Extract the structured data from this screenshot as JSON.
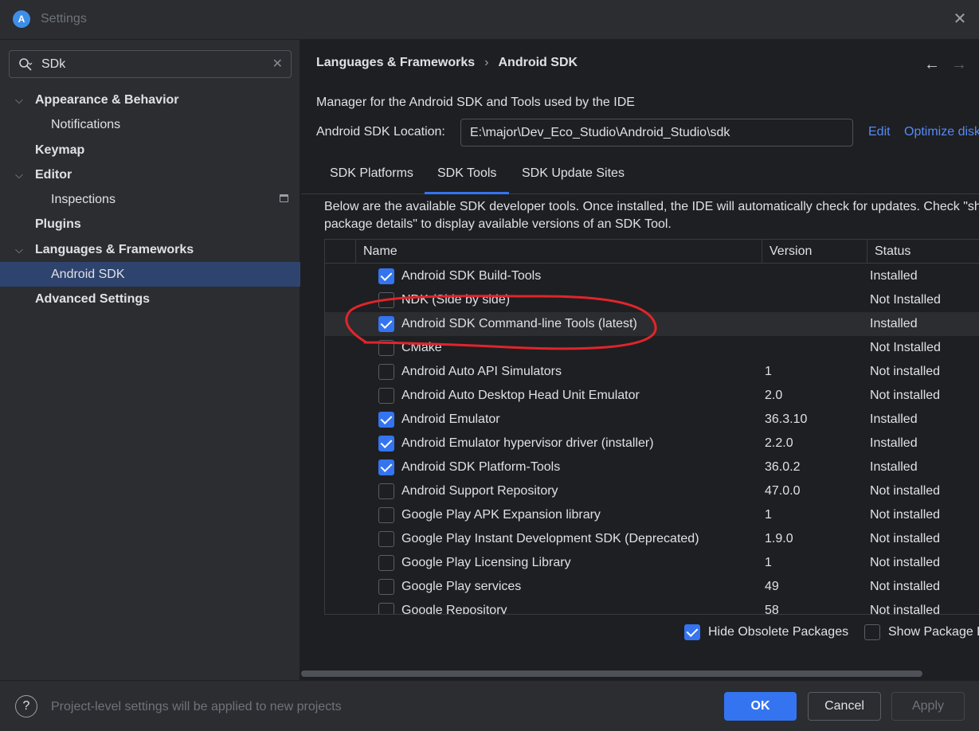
{
  "window": {
    "title": "Settings",
    "logo_glyph": "A"
  },
  "sidebar": {
    "search": {
      "value": "SDk",
      "placeholder": ""
    },
    "items": [
      {
        "label": "Appearance & Behavior",
        "expanded": true
      },
      {
        "label": "Notifications"
      },
      {
        "label": "Keymap"
      },
      {
        "label": "Editor",
        "expanded": true
      },
      {
        "label": "Inspections"
      },
      {
        "label": "Plugins"
      },
      {
        "label": "Languages & Frameworks",
        "expanded": true
      },
      {
        "label": "Android SDK",
        "selected": true
      },
      {
        "label": "Advanced Settings"
      }
    ]
  },
  "main": {
    "breadcrumb": [
      "Languages & Frameworks",
      "Android SDK"
    ],
    "description": "Manager for the Android SDK and Tools used by the IDE",
    "location_label": "Android SDK Location:",
    "location_value": "E:\\major\\Dev_Eco_Studio\\Android_Studio\\sdk",
    "edit_link": "Edit",
    "optimize_link": "Optimize disk space",
    "tabs": [
      "SDK Platforms",
      "SDK Tools",
      "SDK Update Sites"
    ],
    "active_tab": "SDK Tools",
    "info_line1": "Below are the available SDK developer tools. Once installed, the IDE will automatically check for updates. Check \"show",
    "info_line2": "package details\" to display available versions of an SDK Tool.",
    "columns": {
      "name": "Name",
      "version": "Version",
      "status": "Status"
    },
    "rows": [
      {
        "checked": true,
        "name": "Android SDK Build-Tools",
        "version": "",
        "status": "Installed"
      },
      {
        "checked": false,
        "name": "NDK (Side by side)",
        "version": "",
        "status": "Not Installed"
      },
      {
        "checked": true,
        "name": "Android SDK Command-line Tools (latest)",
        "version": "",
        "status": "Installed",
        "highlight": true
      },
      {
        "checked": false,
        "name": "CMake",
        "version": "",
        "status": "Not Installed"
      },
      {
        "checked": false,
        "name": "Android Auto API Simulators",
        "version": "1",
        "status": "Not installed"
      },
      {
        "checked": false,
        "name": "Android Auto Desktop Head Unit Emulator",
        "version": "2.0",
        "status": "Not installed"
      },
      {
        "checked": true,
        "name": "Android Emulator",
        "version": "36.3.10",
        "status": "Installed"
      },
      {
        "checked": true,
        "name": "Android Emulator hypervisor driver (installer)",
        "version": "2.2.0",
        "status": "Installed"
      },
      {
        "checked": true,
        "name": "Android SDK Platform-Tools",
        "version": "36.0.2",
        "status": "Installed"
      },
      {
        "checked": false,
        "name": "Android Support Repository",
        "version": "47.0.0",
        "status": "Not installed"
      },
      {
        "checked": false,
        "name": "Google Play APK Expansion library",
        "version": "1",
        "status": "Not installed"
      },
      {
        "checked": false,
        "name": "Google Play Instant Development SDK (Deprecated)",
        "version": "1.9.0",
        "status": "Not installed"
      },
      {
        "checked": false,
        "name": "Google Play Licensing Library",
        "version": "1",
        "status": "Not installed"
      },
      {
        "checked": false,
        "name": "Google Play services",
        "version": "49",
        "status": "Not installed"
      },
      {
        "checked": false,
        "name": "Google Repository",
        "version": "58",
        "status": "Not installed"
      }
    ],
    "hide_obsolete": {
      "label": "Hide Obsolete Packages",
      "checked": true
    },
    "show_details": {
      "label": "Show Package Details",
      "checked": false
    }
  },
  "footer": {
    "help_glyph": "?",
    "note": "Project-level settings will be applied to new projects",
    "ok": "OK",
    "cancel": "Cancel",
    "apply": "Apply"
  },
  "colors": {
    "accent": "#3574f0",
    "link": "#548af7",
    "annotation": "#e0252a"
  }
}
